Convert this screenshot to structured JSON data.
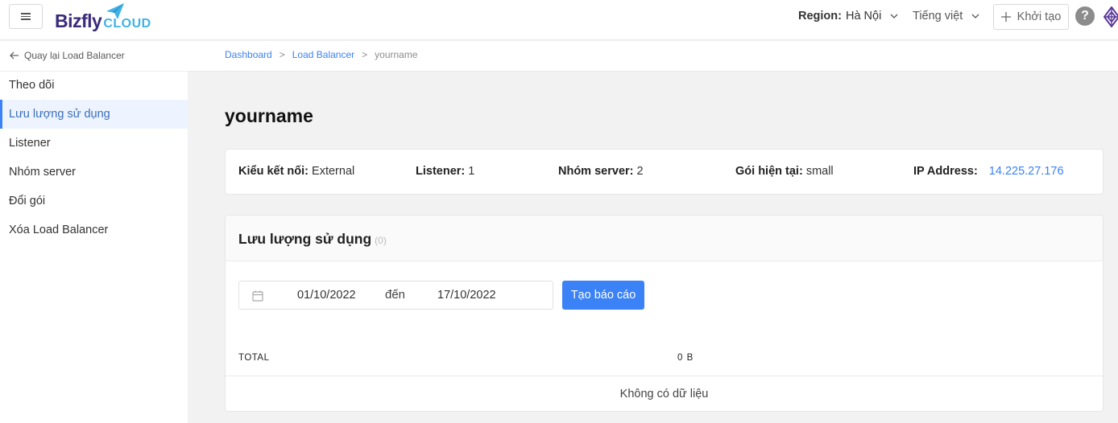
{
  "header": {
    "logo_main": "Bizfly",
    "logo_accent": "CLOUD",
    "region_label": "Region:",
    "region_value": "Hà Nội",
    "language": "Tiếng việt",
    "create_label": "Khởi tạo",
    "help_symbol": "?"
  },
  "sidebar": {
    "back_label": "Quay lại Load Balancer",
    "items": [
      {
        "label": "Theo dõi"
      },
      {
        "label": "Lưu lượng sử dụng",
        "active": true
      },
      {
        "label": "Listener"
      },
      {
        "label": "Nhóm server"
      },
      {
        "label": "Đổi gói"
      },
      {
        "label": "Xóa Load Balancer"
      }
    ]
  },
  "breadcrumb": {
    "items": [
      "Dashboard",
      "Load Balancer",
      "yourname"
    ],
    "separator": ">"
  },
  "page": {
    "title": "yourname"
  },
  "info": {
    "connection_type_label": "Kiểu kết nối:",
    "connection_type_value": "External",
    "listener_label": "Listener:",
    "listener_value": "1",
    "server_group_label": "Nhóm server:",
    "server_group_value": "2",
    "plan_label": "Gói hiện tại:",
    "plan_value": "small",
    "ip_label": "IP Address:",
    "ip_value": "14.225.27.176"
  },
  "usage": {
    "title": "Lưu lượng sử dụng",
    "count": "(0)",
    "date_start": "01/10/2022",
    "date_separator": "đến",
    "date_end": "17/10/2022",
    "report_button": "Tạo báo cáo",
    "total_label": "TOTAL",
    "total_value": "0 B",
    "empty_text": "Không có dữ liệu"
  },
  "colors": {
    "primary": "#3b82f6",
    "logo_dark": "#3a2a7a",
    "logo_light": "#3fb3e5"
  }
}
